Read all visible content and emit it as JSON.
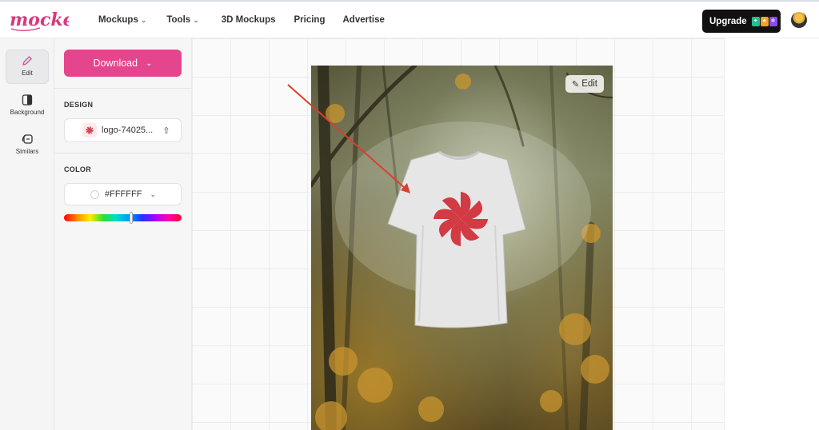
{
  "brand": {
    "logo_text": "mockey",
    "logo_color": "#d63a7e"
  },
  "nav": {
    "items": [
      {
        "label": "Mockups",
        "has_dropdown": true
      },
      {
        "label": "Tools",
        "has_dropdown": true
      },
      {
        "label": "3D Mockups",
        "has_dropdown": false
      },
      {
        "label": "Pricing",
        "has_dropdown": false
      },
      {
        "label": "Advertise",
        "has_dropdown": false
      }
    ],
    "upgrade_label": "Upgrade"
  },
  "rail": {
    "items": [
      {
        "label": "Edit",
        "icon": "pencil-icon",
        "active": true
      },
      {
        "label": "Background",
        "icon": "background-icon",
        "active": false
      },
      {
        "label": "Similars",
        "icon": "similars-icon",
        "active": false
      }
    ]
  },
  "panel": {
    "download_label": "Download",
    "design_heading": "DESIGN",
    "design_file": "logo-74025...",
    "color_heading": "COLOR",
    "color_value": "#FFFFFF",
    "hue_position": 0.6
  },
  "canvas": {
    "edit_label": "Edit",
    "tshirt_color": "#FFFFFF",
    "design_color": "#d23a44"
  },
  "colors": {
    "accent": "#e4458c",
    "upgrade_bg": "#111111",
    "annotation_arrow": "#d8402f"
  }
}
